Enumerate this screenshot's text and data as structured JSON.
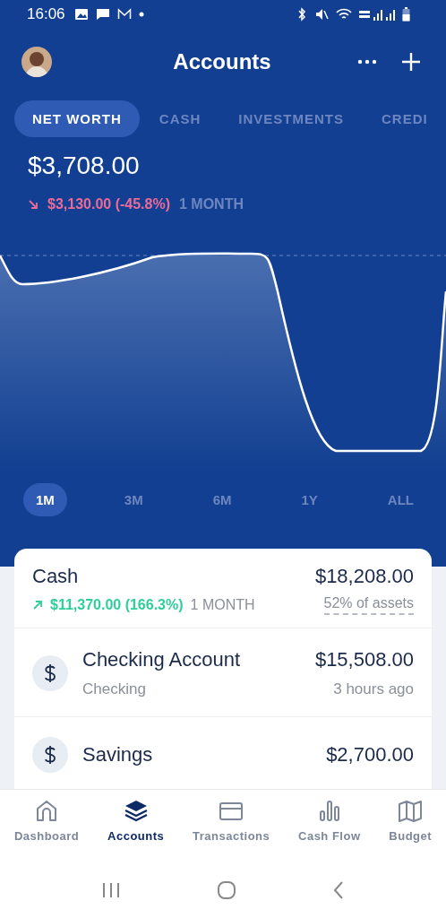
{
  "status_bar": {
    "time": "16:06"
  },
  "header": {
    "title": "Accounts"
  },
  "tabs": [
    {
      "label": "NET WORTH",
      "selected": true
    },
    {
      "label": "CASH",
      "selected": false
    },
    {
      "label": "INVESTMENTS",
      "selected": false
    },
    {
      "label": "CREDI",
      "selected": false
    }
  ],
  "net_worth": {
    "amount": "$3,708.00",
    "change": {
      "kind": "down",
      "value": "$3,130.00 (-45.8%)",
      "period": "1 MONTH"
    }
  },
  "ranges": [
    {
      "label": "1M",
      "selected": true
    },
    {
      "label": "3M",
      "selected": false
    },
    {
      "label": "6M",
      "selected": false
    },
    {
      "label": "1Y",
      "selected": false
    },
    {
      "label": "ALL",
      "selected": false
    }
  ],
  "group": {
    "name": "Cash",
    "total": "$18,208.00",
    "change": {
      "kind": "up",
      "value": "$11,370.00 (166.3%)",
      "period": "1 MONTH"
    },
    "share": "52% of assets"
  },
  "accounts": [
    {
      "name": "Checking Account",
      "type": "Checking",
      "balance": "$15,508.00",
      "updated": "3 hours ago"
    },
    {
      "name": "Savings",
      "balance": "$2,700.00"
    }
  ],
  "nav": [
    {
      "label": "Dashboard",
      "kind": "home",
      "selected": false
    },
    {
      "label": "Accounts",
      "kind": "layers",
      "selected": true
    },
    {
      "label": "Transactions",
      "kind": "card",
      "selected": false
    },
    {
      "label": "Cash Flow",
      "kind": "bars",
      "selected": false
    },
    {
      "label": "Budget",
      "kind": "map",
      "selected": false
    }
  ]
}
